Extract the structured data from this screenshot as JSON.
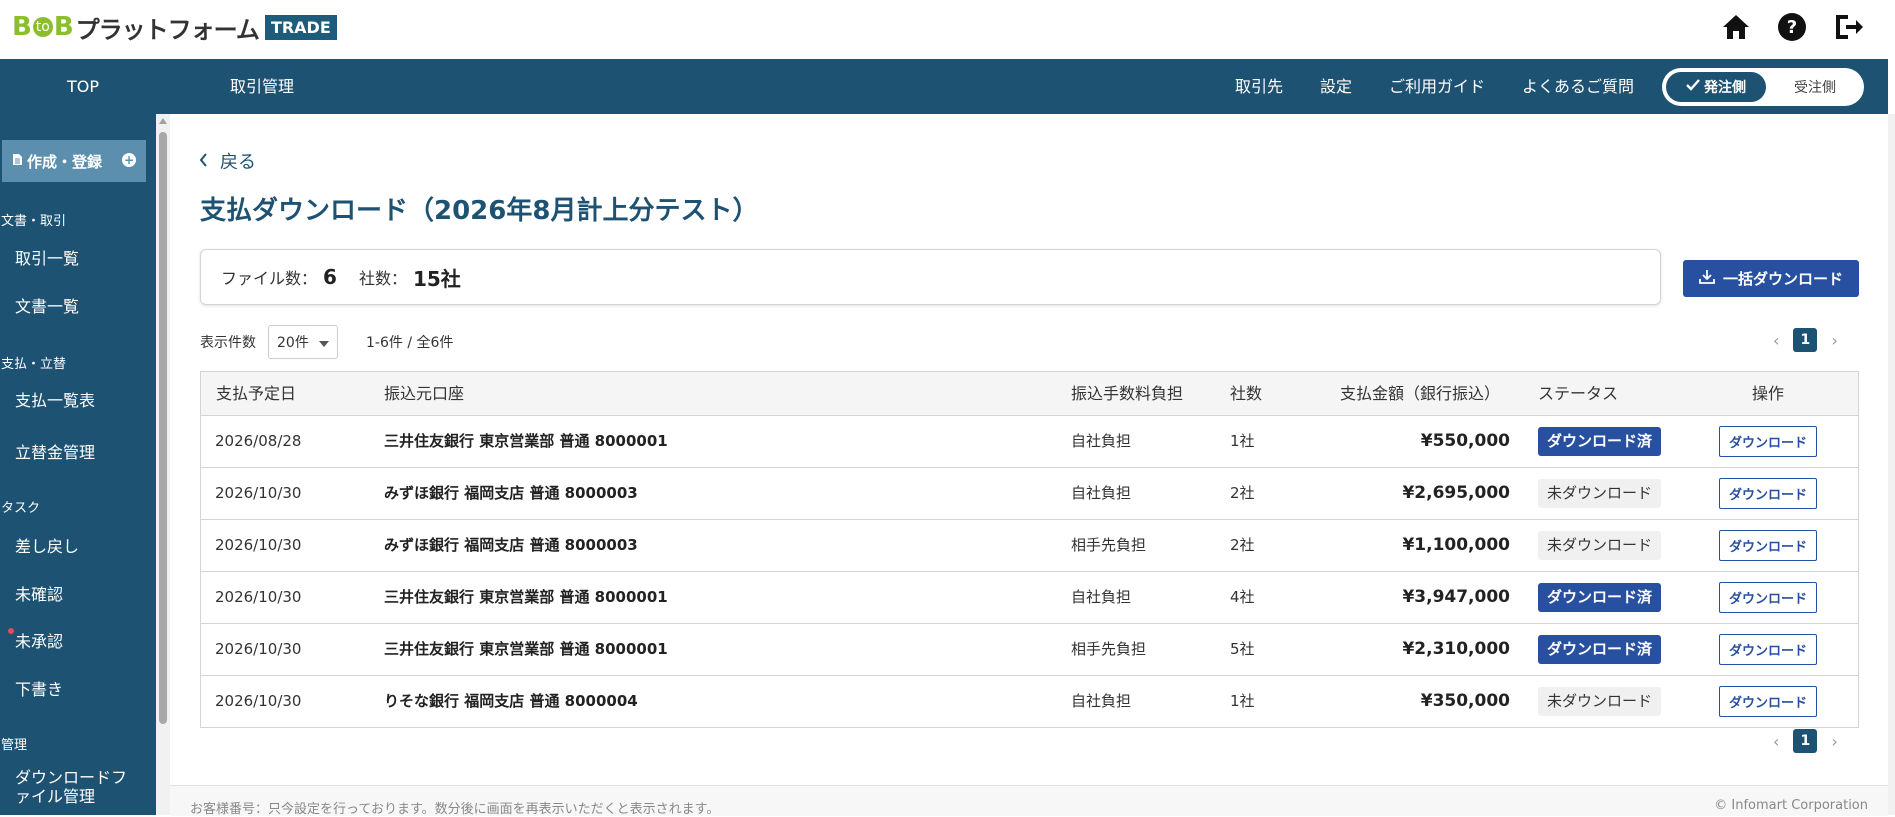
{
  "header": {
    "logo_b1": "B",
    "logo_to": "to",
    "logo_b2": "B",
    "logo_name": "プラットフォーム",
    "logo_trade": "TRADE",
    "icons": [
      "home-icon",
      "help-icon",
      "logout-icon"
    ]
  },
  "nav": {
    "top": "TOP",
    "trade_mgmt": "取引管理",
    "partners": "取引先",
    "settings": "設定",
    "guide": "ご利用ガイド",
    "faq": "よくあるご質問",
    "toggle_on": "発注側",
    "toggle_off": "受注側"
  },
  "sidebar": {
    "create": "作成・登録",
    "sec_docs": "文書・取引",
    "trade_list": "取引一覧",
    "doc_list": "文書一覧",
    "sec_pay": "支払・立替",
    "pay_list": "支払一覧表",
    "advance": "立替金管理",
    "sec_task": "タスク",
    "returned": "差し戻し",
    "unconfirmed": "未確認",
    "unapproved": "未承認",
    "draft": "下書き",
    "sec_mgmt": "管理",
    "dl_file_1": "ダウンロードフ",
    "dl_file_2": "ァイル管理"
  },
  "main": {
    "back": "戻る",
    "title": "支払ダウンロード（2026年8月計上分テスト）",
    "file_count_label": "ファイル数：",
    "file_count": "6",
    "company_count_label": "社数：",
    "company_count": "15社",
    "bulk_download": "一括ダウンロード",
    "per_page_label": "表示件数",
    "per_page_value": "20件",
    "range": "1-6件 / 全6件",
    "page": "1"
  },
  "table": {
    "headers": {
      "date": "支払予定日",
      "account": "振込元口座",
      "fee": "振込手数料負担",
      "companies": "社数",
      "amount": "支払金額（銀行振込）",
      "status": "ステータス",
      "action": "操作"
    },
    "rows": [
      {
        "date": "2026/08/28",
        "account": "三井住友銀行 東京営業部 普通 8000001",
        "fee": "自社負担",
        "companies": "1社",
        "amount": "¥550,000",
        "status": "ダウンロード済",
        "done": true,
        "action": "ダウンロード"
      },
      {
        "date": "2026/10/30",
        "account": "みずほ銀行 福岡支店 普通 8000003",
        "fee": "自社負担",
        "companies": "2社",
        "amount": "¥2,695,000",
        "status": "未ダウンロード",
        "done": false,
        "action": "ダウンロード"
      },
      {
        "date": "2026/10/30",
        "account": "みずほ銀行 福岡支店 普通 8000003",
        "fee": "相手先負担",
        "companies": "2社",
        "amount": "¥1,100,000",
        "status": "未ダウンロード",
        "done": false,
        "action": "ダウンロード"
      },
      {
        "date": "2026/10/30",
        "account": "三井住友銀行 東京営業部 普通 8000001",
        "fee": "自社負担",
        "companies": "4社",
        "amount": "¥3,947,000",
        "status": "ダウンロード済",
        "done": true,
        "action": "ダウンロード"
      },
      {
        "date": "2026/10/30",
        "account": "三井住友銀行 東京営業部 普通 8000001",
        "fee": "相手先負担",
        "companies": "5社",
        "amount": "¥2,310,000",
        "status": "ダウンロード済",
        "done": true,
        "action": "ダウンロード"
      },
      {
        "date": "2026/10/30",
        "account": "りそな銀行 福岡支店 普通 8000004",
        "fee": "自社負担",
        "companies": "1社",
        "amount": "¥350,000",
        "status": "未ダウンロード",
        "done": false,
        "action": "ダウンロード"
      }
    ]
  },
  "footer": {
    "notice": "お客様番号：只今設定を行っております。数分後に画面を再表示いただくと表示されます。",
    "copyright": "© Infomart Corporation"
  },
  "colors": {
    "primary": "#1e5272",
    "button": "#2850a0",
    "brand_green": "#8bbf2a",
    "alert_dot": "#e24b5a"
  }
}
